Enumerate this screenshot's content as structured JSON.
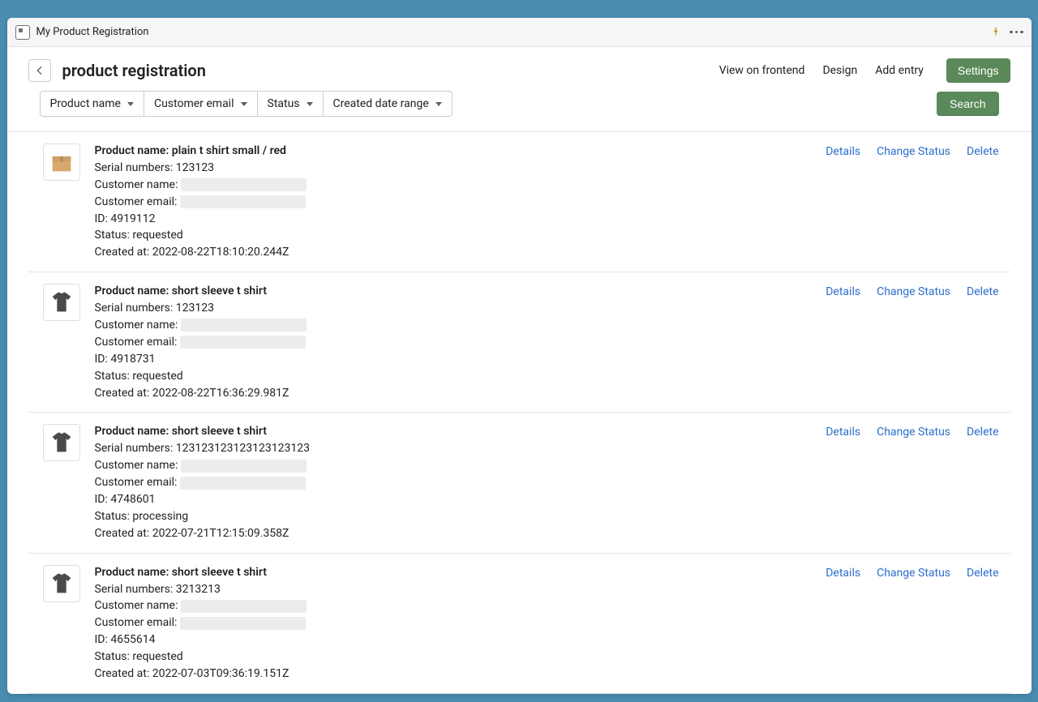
{
  "app_title": "My Product Registration",
  "page_title": "product registration",
  "header_links": {
    "view_frontend": "View on frontend",
    "design": "Design",
    "add_entry": "Add entry",
    "settings": "Settings"
  },
  "filters": {
    "product_name": "Product name",
    "customer_email": "Customer email",
    "status": "Status",
    "created_range": "Created date range"
  },
  "search_label": "Search",
  "labels": {
    "product_name": "Product name: ",
    "serials": "Serial numbers: ",
    "customer_name": "Customer name: ",
    "customer_email": "Customer email: ",
    "id": "ID: ",
    "status": "Status: ",
    "created_at": "Created at: "
  },
  "row_actions": {
    "details": "Details",
    "change_status": "Change Status",
    "delete": "Delete"
  },
  "entries": [
    {
      "thumb": "box",
      "product_name": "plain t shirt small / red",
      "serials": "123123",
      "customer_name": "",
      "customer_email": "",
      "id": "4919112",
      "status": "requested",
      "created_at": "2022-08-22T18:10:20.244Z"
    },
    {
      "thumb": "tshirt",
      "product_name": "short sleeve t shirt",
      "serials": "123123",
      "customer_name": "",
      "customer_email": "",
      "id": "4918731",
      "status": "requested",
      "created_at": "2022-08-22T16:36:29.981Z"
    },
    {
      "thumb": "tshirt",
      "product_name": "short sleeve t shirt",
      "serials": "123123123123123123123",
      "customer_name": "",
      "customer_email": "",
      "id": "4748601",
      "status": "processing",
      "created_at": "2022-07-21T12:15:09.358Z"
    },
    {
      "thumb": "tshirt",
      "product_name": "short sleeve t shirt",
      "serials": "3213213",
      "customer_name": "",
      "customer_email": "",
      "id": "4655614",
      "status": "requested",
      "created_at": "2022-07-03T09:36:19.151Z"
    }
  ]
}
